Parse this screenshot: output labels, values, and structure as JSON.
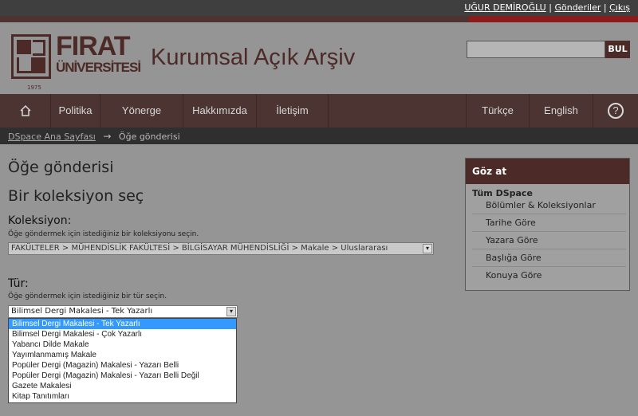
{
  "user_bar": {
    "user": "UĞUR DEMİROĞLU",
    "submissions": "Gönderiler",
    "logout": "Çıkış",
    "sep": "|"
  },
  "header": {
    "logo_top": "FIRAT",
    "logo_bottom": "ÜNİVERSİTESİ",
    "logo_year": "1975",
    "title": "Kurumsal Açık Arşiv",
    "search_button": "BUL",
    "search_value": ""
  },
  "nav": {
    "home_icon": "home-icon",
    "items": [
      "Politika",
      "Yönerge",
      "Hakkımızda",
      "İletişim"
    ],
    "lang": [
      "Türkçe",
      "English"
    ],
    "help": "?"
  },
  "breadcrumb": {
    "home": "DSpace Ana Sayfası",
    "arrow": "→",
    "current": "Öğe gönderisi"
  },
  "main": {
    "title": "Öğe gönderisi",
    "subtitle": "Bir koleksiyon seç",
    "collection_label": "Koleksiyon:",
    "collection_help": "Öğe göndermek için istediğiniz bir koleksiyonu seçin.",
    "collection_value": "FAKÜLTELER > MÜHENDİSLİK FAKÜLTESİ > BİLGİSAYAR MÜHENDİSLİĞİ > Makale > Uluslararası",
    "type_label": "Tür:",
    "type_help": "Öğe göndermek için istediğiniz bir tür seçin.",
    "type_value": "Bilimsel Dergi Makalesi - Tek Yazarlı",
    "type_options": [
      "Bilimsel Dergi Makalesi - Tek Yazarlı",
      "Bilimsel Dergi Makalesi - Çok Yazarlı",
      "Yabancı Dilde Makale",
      "Yayımlanmamış Makale",
      "Popüler Dergi (Magazin) Makalesi - Yazarı Belli",
      "Popüler Dergi (Magazin) Makalesi - Yazarı Belli Değil",
      "Gazete Makalesi",
      "Kitap Tanıtımları"
    ]
  },
  "sidebar": {
    "header": "Göz at",
    "category": "Tüm DSpace",
    "items": [
      "Bölümler & Koleksiyonlar",
      "Tarihe Göre",
      "Yazara Göre",
      "Başlığa Göre",
      "Konuya Göre"
    ]
  },
  "colors": {
    "brand": "#4c2a28",
    "selection": "#3399ff",
    "background": "#959595"
  }
}
